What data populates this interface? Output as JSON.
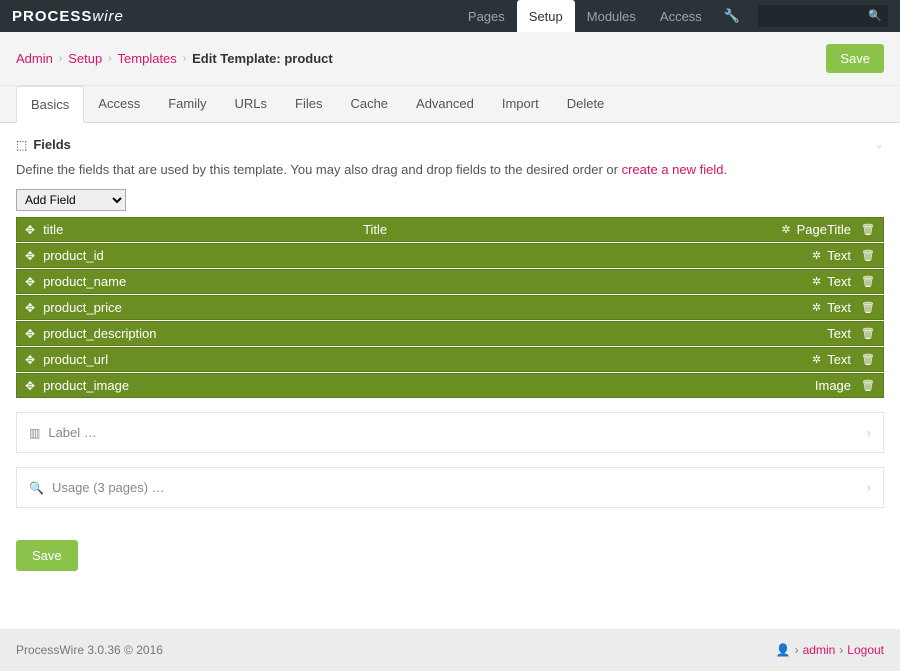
{
  "logo": {
    "bold": "PROCESS",
    "italic": "wire"
  },
  "topnav": {
    "pages": "Pages",
    "setup": "Setup",
    "modules": "Modules",
    "access": "Access"
  },
  "breadcrumb": {
    "admin": "Admin",
    "setup": "Setup",
    "templates": "Templates",
    "current": "Edit Template: product"
  },
  "save": "Save",
  "tabs": {
    "basics": "Basics",
    "access": "Access",
    "family": "Family",
    "urls": "URLs",
    "files": "Files",
    "cache": "Cache",
    "advanced": "Advanced",
    "import": "Import",
    "delete": "Delete"
  },
  "fields_section": {
    "title": "Fields",
    "desc_before": "Define the fields that are used by this template. You may also drag and drop fields to the desired order or ",
    "desc_link": "create a new field",
    "desc_after": ".",
    "add_field": "Add Field"
  },
  "field_header": {
    "name": "title",
    "label": "Title",
    "type": "PageTitle"
  },
  "fields": [
    {
      "name": "product_id",
      "type": "Text",
      "gear": true
    },
    {
      "name": "product_name",
      "type": "Text",
      "gear": true
    },
    {
      "name": "product_price",
      "type": "Text",
      "gear": true
    },
    {
      "name": "product_description",
      "type": "Text",
      "gear": false
    },
    {
      "name": "product_url",
      "type": "Text",
      "gear": true
    },
    {
      "name": "product_image",
      "type": "Image",
      "gear": false
    }
  ],
  "label_panel": "Label …",
  "usage_panel": "Usage (3 pages) …",
  "footer": {
    "version": "ProcessWire 3.0.36 © 2016",
    "admin": "admin",
    "logout": "Logout"
  }
}
